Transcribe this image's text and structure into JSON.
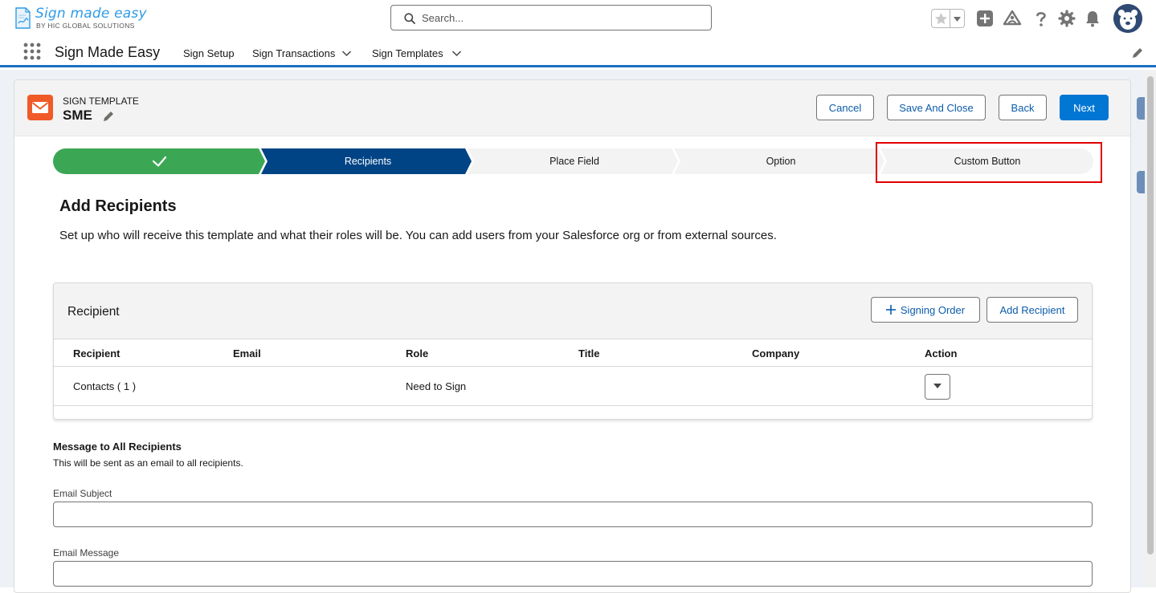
{
  "header": {
    "logo": {
      "brand": "Sign made easy",
      "tagline": "BY HIC GLOBAL SOLUTIONS"
    },
    "search": {
      "placeholder": "Search..."
    },
    "icons": [
      "favorites-star-icon",
      "favorites-dropdown-icon",
      "global-add-icon",
      "trailhead-icon",
      "help-icon",
      "setup-gear-icon",
      "notifications-bell-icon",
      "user-avatar"
    ]
  },
  "nav": {
    "app_name": "Sign Made Easy",
    "items": [
      {
        "label": "Sign Setup",
        "has_menu": false
      },
      {
        "label": "Sign Transactions",
        "has_menu": true
      },
      {
        "label": "Sign Templates",
        "has_menu": true
      }
    ]
  },
  "page_header": {
    "object_label": "SIGN TEMPLATE",
    "record_name": "SME",
    "buttons": {
      "cancel": "Cancel",
      "save_close": "Save And Close",
      "back": "Back",
      "next": "Next"
    }
  },
  "path": {
    "steps": [
      {
        "label": "",
        "state": "complete"
      },
      {
        "label": "Recipients",
        "state": "current"
      },
      {
        "label": "Place Field",
        "state": "incomplete"
      },
      {
        "label": "Option",
        "state": "incomplete"
      },
      {
        "label": "Custom Button",
        "state": "incomplete"
      }
    ],
    "highlighted_step": "Custom Button"
  },
  "section": {
    "title": "Add Recipients",
    "description": "Set up who will receive this template and what their roles will be. You can add users from your Salesforce org or from external sources."
  },
  "recipients": {
    "title": "Recipient",
    "signing_order_label": "Signing Order",
    "add_recipient_label": "Add Recipient",
    "columns": [
      "Recipient",
      "Email",
      "Role",
      "Title",
      "Company",
      "Action"
    ],
    "rows": [
      {
        "recipient": "Contacts ( 1 )",
        "email": "",
        "role": "Need to Sign",
        "title": "",
        "company": ""
      }
    ]
  },
  "message": {
    "title": "Message to All Recipients",
    "description": "This will be sent as an email to all recipients.",
    "subject_label": "Email Subject",
    "subject_value": "",
    "body_label": "Email Message",
    "body_value": ""
  },
  "colors": {
    "brand_blue": "#0176d3",
    "path_complete": "#3ba755",
    "path_current": "#014486",
    "path_incomplete": "#f3f3f3",
    "highlight_red": "#e00000",
    "object_icon": "#f05a28"
  }
}
